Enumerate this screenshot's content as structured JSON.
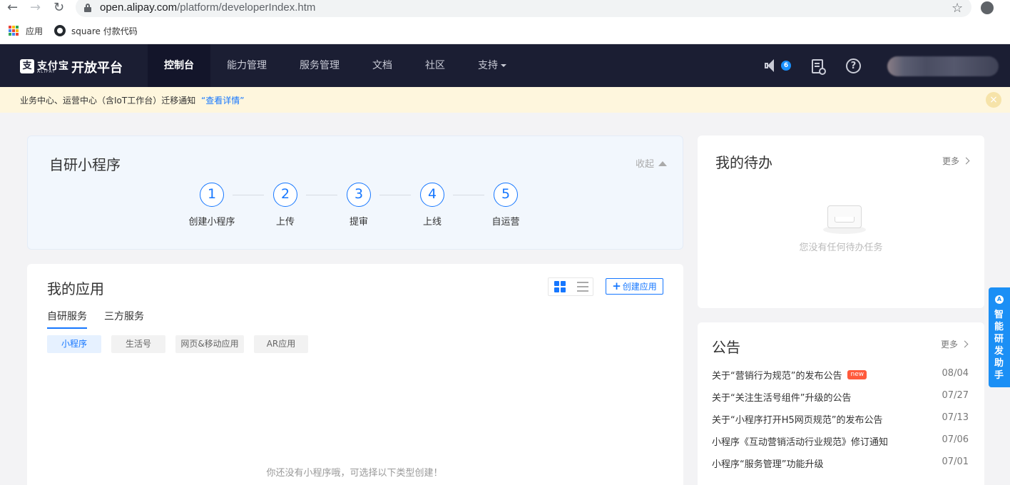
{
  "browser": {
    "url_host": "open.alipay.com",
    "url_path": "/platform/developerIndex.htm",
    "bookmarks": [
      {
        "label": "应用"
      },
      {
        "label": "square 付款代码"
      }
    ]
  },
  "header": {
    "logo_text": "支付宝",
    "logo_sub": "ALIPAY",
    "platform_title": "开放平台",
    "nav": [
      {
        "label": "控制台",
        "active": true
      },
      {
        "label": "能力管理"
      },
      {
        "label": "服务管理"
      },
      {
        "label": "文档"
      },
      {
        "label": "社区"
      },
      {
        "label": "支持"
      }
    ],
    "notification_count": "6",
    "help_symbol": "?"
  },
  "notice": {
    "text": "业务中心、运营中心（含IoT工作台）迁移通知",
    "link": "“查看详情”",
    "close_symbol": "×"
  },
  "miniprogram_card": {
    "title": "自研小程序",
    "collapse_label": "收起",
    "steps": [
      {
        "num": "1",
        "label": "创建小程序"
      },
      {
        "num": "2",
        "label": "上传"
      },
      {
        "num": "3",
        "label": "提审"
      },
      {
        "num": "4",
        "label": "上线"
      },
      {
        "num": "5",
        "label": "自运营"
      }
    ]
  },
  "apps_card": {
    "title": "我的应用",
    "create_label": "创建应用",
    "create_symbol": "+",
    "tabs": [
      {
        "label": "自研服务",
        "active": true
      },
      {
        "label": "三方服务"
      }
    ],
    "chips": [
      {
        "label": "小程序",
        "active": true
      },
      {
        "label": "生活号"
      },
      {
        "label": "网页&移动应用"
      },
      {
        "label": "AR应用"
      }
    ],
    "empty_text": "你还没有小程序哦，可选择以下类型创建！"
  },
  "todo_card": {
    "title": "我的待办",
    "more_label": "更多",
    "empty_text": "您没有任何待办任务"
  },
  "announce_card": {
    "title": "公告",
    "more_label": "更多",
    "new_badge": "new",
    "items": [
      {
        "title": "关于“营销行为规范”的发布公告",
        "date": "08/04"
      },
      {
        "title": "关于“关注生活号组件”升级的公告",
        "date": "07/27"
      },
      {
        "title": "关于“小程序打开H5网页规范”的发布公告",
        "date": "07/13"
      },
      {
        "title": "小程序《互动营销活动行业规范》修订通知",
        "date": "07/06"
      },
      {
        "title": "小程序“服务管理”功能升级",
        "date": "07/01"
      }
    ]
  },
  "assistant": {
    "label": "智能研发助手"
  },
  "colors": {
    "header_bg": "#1b1e33",
    "accent": "#1677ff",
    "notice_bg": "#fef6dd",
    "new_badge": "#ff5a3c"
  }
}
